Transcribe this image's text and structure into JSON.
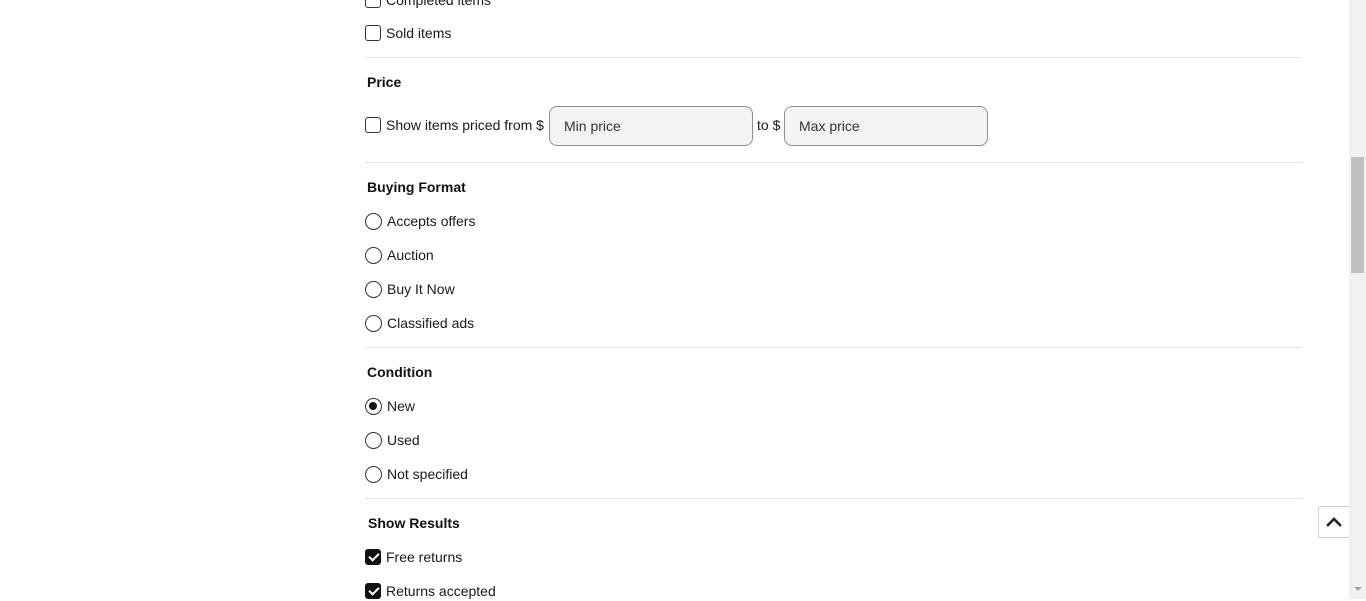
{
  "listing_type": {
    "options": [
      {
        "label": "Completed items",
        "checked": false
      },
      {
        "label": "Sold items",
        "checked": false
      }
    ]
  },
  "price": {
    "heading": "Price",
    "checkbox_label": "Show items priced from $",
    "checked": false,
    "min_placeholder": "Min price",
    "to_label": "to $",
    "max_placeholder": "Max price"
  },
  "buying_format": {
    "heading": "Buying Format",
    "options": [
      {
        "label": "Accepts offers",
        "checked": false
      },
      {
        "label": "Auction",
        "checked": false
      },
      {
        "label": "Buy It Now",
        "checked": false
      },
      {
        "label": "Classified ads",
        "checked": false
      }
    ]
  },
  "condition": {
    "heading": "Condition",
    "options": [
      {
        "label": "New",
        "checked": true
      },
      {
        "label": "Used",
        "checked": false
      },
      {
        "label": "Not specified",
        "checked": false
      }
    ]
  },
  "show_results": {
    "heading": "Show Results",
    "options": [
      {
        "label": "Free returns",
        "checked": true
      },
      {
        "label": "Returns accepted",
        "checked": true
      }
    ]
  },
  "icons": {
    "back_to_top": "chevron-up-icon"
  }
}
